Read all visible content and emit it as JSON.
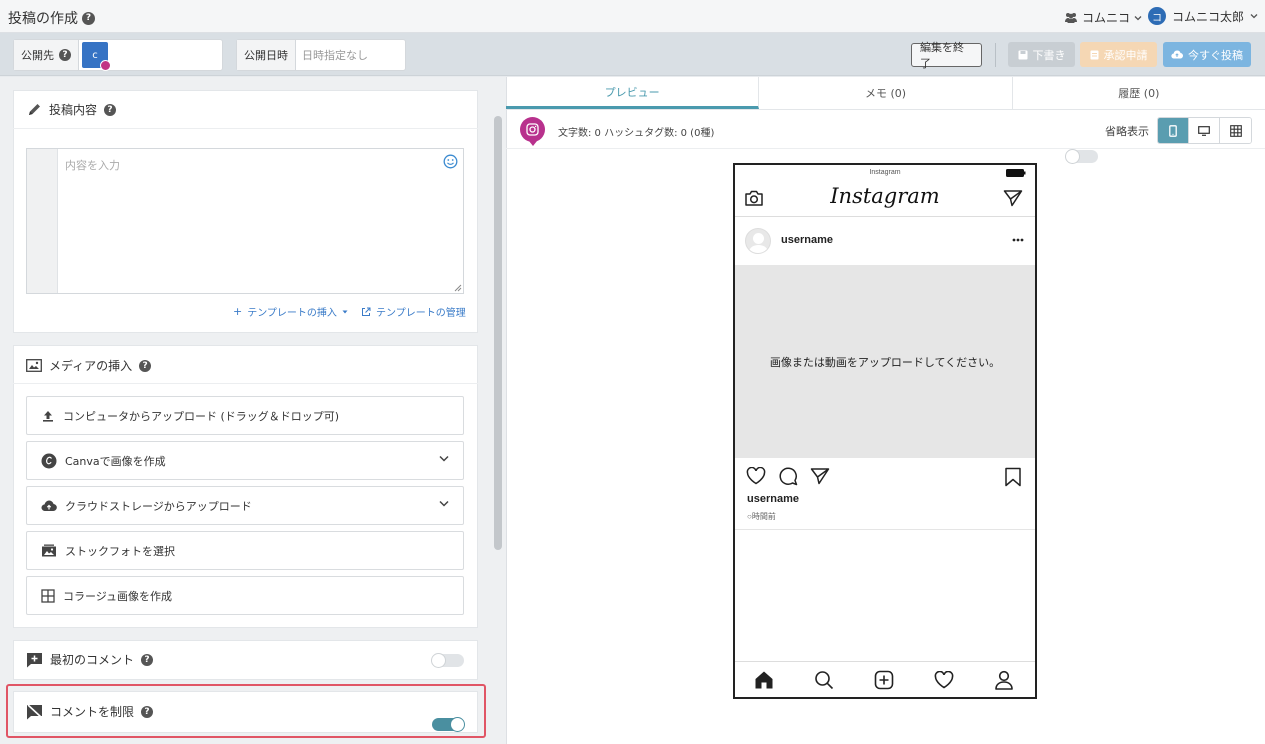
{
  "header": {
    "title": "投稿の作成",
    "workspace": "コムニコ",
    "user_initial": "コ",
    "user_name": "コムニコ太郎"
  },
  "toolbar": {
    "destination_label": "公開先",
    "account_initial": "c",
    "date_label": "公開日時",
    "date_placeholder": "日時指定なし",
    "end_edit_label": "編集を終了",
    "draft_label": "下書き",
    "approval_label": "承認申請",
    "post_now_label": "今すぐ投稿"
  },
  "post_content": {
    "heading": "投稿内容",
    "placeholder": "内容を入力",
    "insert_template": "テンプレートの挿入",
    "manage_template": "テンプレートの管理"
  },
  "media": {
    "heading": "メディアの挿入",
    "options": [
      {
        "label": "コンピュータからアップロード (ドラッグ＆ドロップ可)",
        "icon": "upload-icon"
      },
      {
        "label": "Canvaで画像を作成",
        "icon": "canva-icon"
      },
      {
        "label": "クラウドストレージからアップロード",
        "icon": "cloud-upload-icon"
      },
      {
        "label": "ストックフォトを選択",
        "icon": "stock-photo-icon"
      },
      {
        "label": "コラージュ画像を作成",
        "icon": "grid-icon"
      }
    ]
  },
  "first_comment": {
    "label": "最初のコメント",
    "enabled": false
  },
  "restrict_comments": {
    "label": "コメントを制限",
    "enabled": true
  },
  "tabs": [
    {
      "label": "プレビュー",
      "active": true
    },
    {
      "label": "メモ (0)",
      "active": false
    },
    {
      "label": "履歴 (0)",
      "active": false
    }
  ],
  "stats": {
    "text": "文字数: 0 ハッシュタグ数: 0 (0種)",
    "abbrev_label": "省略表示"
  },
  "preview": {
    "status_title": "Instagram",
    "app_name": "Instagram",
    "username": "username",
    "media_placeholder": "画像または動画をアップロードしてください。",
    "caption_username": "username",
    "time_ago": "○時間前"
  },
  "colors": {
    "accent": "#4a9aae",
    "highlight": "#e05565",
    "instagram": "#b8318d"
  }
}
